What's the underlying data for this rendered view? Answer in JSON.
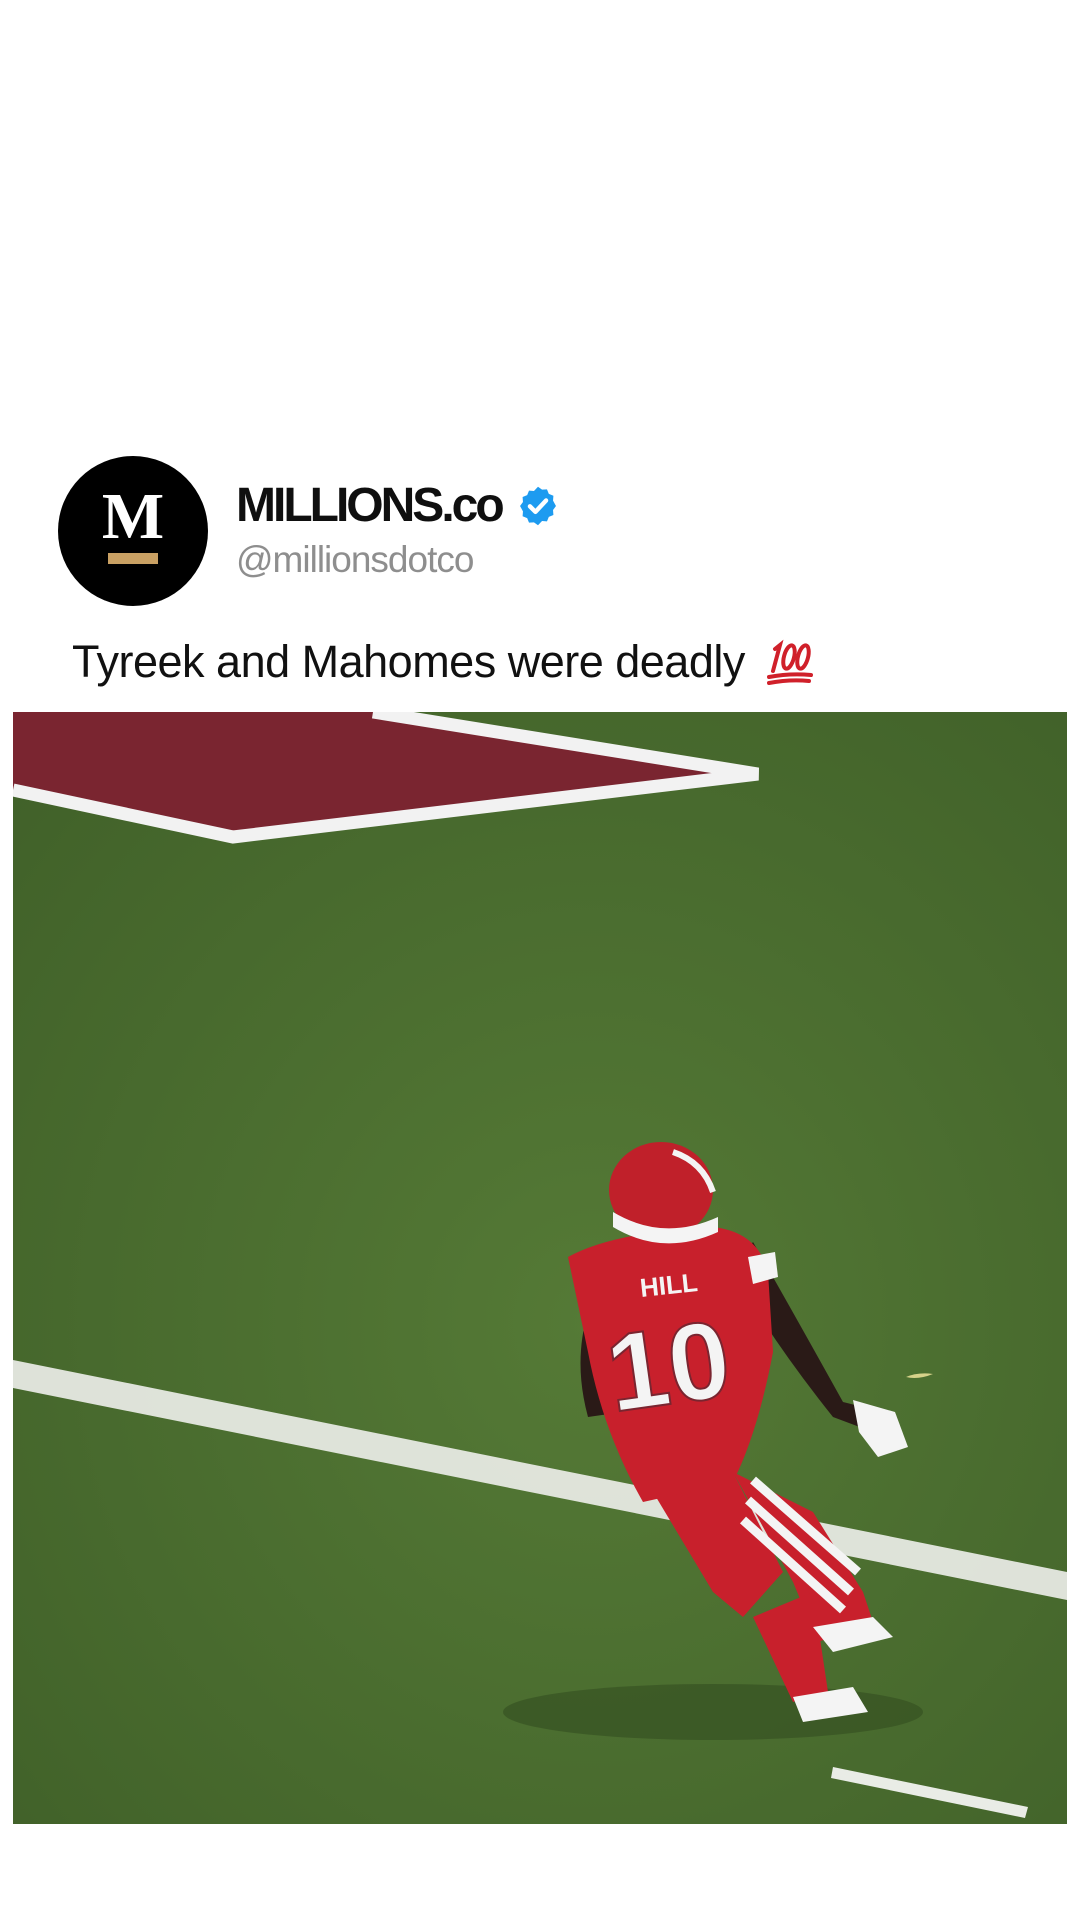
{
  "post": {
    "author": {
      "display_name": "MILLIONS.co",
      "handle": "@millionsdotco",
      "avatar_letter": "M",
      "verified": true
    },
    "caption": "Tyreek and Mahomes were deadly",
    "caption_emoji": "hundred-points-icon",
    "media": {
      "jersey_name": "HILL",
      "jersey_number": "10"
    }
  },
  "colors": {
    "verified_badge": "#1d9bf0",
    "avatar_bg": "#000000",
    "avatar_accent": "#c9a063",
    "field_green": "#4b6e30",
    "end_zone_red": "#7a2530",
    "uniform_red": "#c8202c",
    "handle_gray": "#8e8e8e"
  }
}
